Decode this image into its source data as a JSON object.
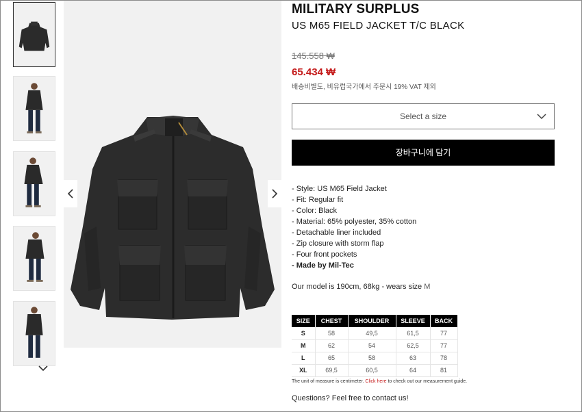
{
  "product": {
    "brand": "MILITARY SURPLUS",
    "title": "US M65 FIELD JACKET T/C BLACK",
    "price_original": "145.558 ₩",
    "price_sale": "65.434 ₩",
    "shipping_note": "배송비별도, 비유럽국가에서 주문시 19% VAT 제외",
    "sale_color": "#c41a1a"
  },
  "gallery": {
    "thumbnail_count": 5,
    "active_index": 0,
    "prev_icon": "chevron-left-icon",
    "next_icon": "chevron-right-icon",
    "more_icon": "chevron-down-icon"
  },
  "size_select": {
    "placeholder": "Select a size",
    "icon": "chevron-down-icon"
  },
  "cart_button": {
    "label": "장바구니에 담기"
  },
  "features": [
    "- Style: US M65 Field Jacket",
    "- Fit: Regular fit",
    "- Color: Black",
    "- Material: 65% polyester, 35% cotton",
    "- Detachable liner included",
    "- Zip closure with storm flap",
    "- Four front pockets",
    "- Made by Mil-Tec"
  ],
  "model_note": {
    "text": "Our model is 190cm, 68kg - wears size ",
    "size": "M"
  },
  "size_table": {
    "headers": [
      "SIZE",
      "CHEST",
      "SHOULDER",
      "SLEEVE",
      "BACK"
    ],
    "rows": [
      [
        "S",
        "58",
        "49,5",
        "61,5",
        "77"
      ],
      [
        "M",
        "62",
        "54",
        "62,5",
        "77"
      ],
      [
        "L",
        "65",
        "58",
        "63",
        "78"
      ],
      [
        "XL",
        "69,5",
        "60,5",
        "64",
        "81"
      ]
    ]
  },
  "measure_note": {
    "before": "The unit of measure is centimeter. ",
    "link": "Click here",
    "after": " to check out our measurement guide."
  },
  "questions": "Questions? Feel free to contact us!"
}
